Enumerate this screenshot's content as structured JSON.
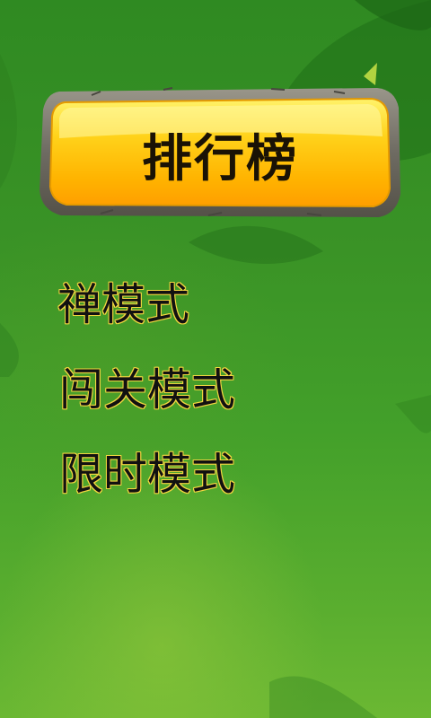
{
  "title": "排行榜",
  "menu": {
    "items": [
      {
        "label": "禅模式"
      },
      {
        "label": "闯关模式"
      },
      {
        "label": "限时模式"
      }
    ]
  },
  "colors": {
    "button_yellow": "#ffd21a",
    "button_orange": "#ff9e00",
    "frame_stone": "#6e6b62",
    "background_green": "#3a9326",
    "menu_outline": "#f2d640"
  }
}
